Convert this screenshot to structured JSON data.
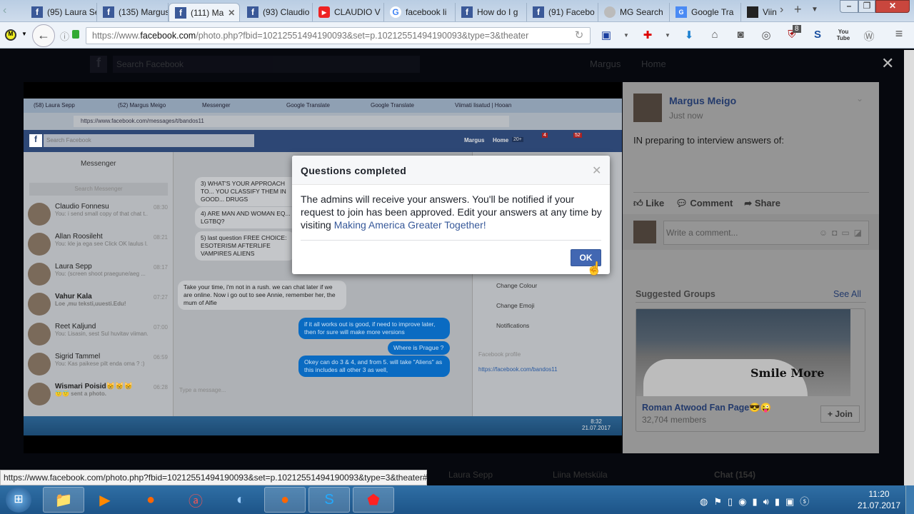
{
  "browser": {
    "tabs": [
      {
        "title": "(95) Laura Sepp",
        "icon": "facebook-icon"
      },
      {
        "title": "(135) Margus",
        "icon": "facebook-icon"
      },
      {
        "title": "(111) Ma",
        "icon": "facebook-icon",
        "active": true
      },
      {
        "title": "(93) Claudio",
        "icon": "facebook-icon"
      },
      {
        "title": "CLAUDIO V",
        "icon": "youtube-icon"
      },
      {
        "title": "facebook li",
        "icon": "google-icon"
      },
      {
        "title": "How do I g",
        "icon": "facebook-icon"
      },
      {
        "title": "(91) Facebo",
        "icon": "facebook-icon"
      },
      {
        "title": "MG Search",
        "icon": "mg-search-icon"
      },
      {
        "title": "Google Tra",
        "icon": "google-translate-icon"
      },
      {
        "title": "Viin",
        "icon": "viin-icon"
      }
    ],
    "url_prefix": "https://www.",
    "url_domain": "facebook.com",
    "url_path": "/photo.php?fbid=10212551494190093&set=p.10212551494190093&type=3&theater",
    "ublock_count": "8",
    "status_url": "https://www.facebook.com/photo.php?fbid=10212551494190093&set=p.10212551494190093&type=3&theater#"
  },
  "fb_header": {
    "search_placeholder": "Search Facebook",
    "user": "Margus",
    "home": "Home"
  },
  "photo": {
    "tabs": [
      "(58) Laura Sepp",
      "(52) Margus Meigo",
      "Messenger",
      "Google Translate",
      "Google Translate",
      "Viimati lisatud | Hooan"
    ],
    "url": "https://www.facebook.com/messages/t/bandos11",
    "search_placeholder": "Search Facebook",
    "user": "Margus",
    "home": "Home",
    "home_badge": "20+",
    "friends_badge": "4",
    "notif_badge": "52",
    "messenger_title": "Messenger",
    "search_messenger": "Search Messenger",
    "conversations": [
      {
        "name": "Claudio Fonnesu",
        "time": "08:30",
        "msg": "You: i send small copy of that chat t..."
      },
      {
        "name": "Allan Roosileht",
        "time": "08:21",
        "msg": "You: kle ja ega see Click OK laulus l..."
      },
      {
        "name": "Laura Sepp",
        "time": "08:17",
        "msg": "You: (screen shoot praegune/aeg ..."
      },
      {
        "name": "Vahur Kala",
        "time": "07:27",
        "msg": "Loe ,mu teksti,uuesti.Edu!"
      },
      {
        "name": "Reet Kaljund",
        "time": "07:00",
        "msg": "You: Lisasin, sest Sul huvitav viiman..."
      },
      {
        "name": "Sigrid Tammel",
        "time": "06:59",
        "msg": "You: Kas paikese pilt enda oma ? :)"
      },
      {
        "name": "Wismari Poisid😸😸😸",
        "time": "06:28",
        "msg": "😇😇 sent a photo."
      }
    ],
    "messages": {
      "q3": "3) WHAT'S YOUR APPROACH TO... YOU CLASSIFY THEM IN GOOD... DRUGS",
      "q4": "4) ARE MAN AND WOMAN EQ... LGTBQ?",
      "q5": "5) last question FREE CHOICE: ESOTERISM AFTERLIFE VAMPIRES ALIENS",
      "reply": "Take your time, i'm not in a rush. we can chat later if we are online. Now i go out to see Annie, remember her, the mum of Alfie",
      "m1": "if it all works out is good, if need to improve later, then for sure will make more versions",
      "m2": "Where is Prague ?",
      "m3": "Okey can do 3 & 4, and from 5. will take \"Aliens\" as this includes all other 3 as well,"
    },
    "type_placeholder": "Type a message...",
    "options": [
      "Change Colour",
      "Change Emoji",
      "Notifications"
    ],
    "profile_label": "Facebook profile",
    "profile_link": "https://facebook.com/bandos11",
    "clock_time": "8:32",
    "clock_date": "21.07.2017"
  },
  "dialog": {
    "title": "Questions completed",
    "body": "The admins will receive your answers. You'll be notified if your request to join has been approved. Edit your answers at any time by visiting ",
    "link": "Making America Greater Together!",
    "ok": "OK"
  },
  "post": {
    "author": "Margus Meigo",
    "time": "Just now",
    "text": "IN preparing to interview answers of:",
    "actions": [
      "Like",
      "Comment",
      "Share"
    ],
    "comment_placeholder": "Write a comment..."
  },
  "suggested": {
    "title": "Suggested Groups",
    "see_all": "See All",
    "group_name": "Roman Atwood Fan Page😎😜",
    "members": "32,704 members",
    "join": "+ Join",
    "image_text": "Smile More"
  },
  "bg_chat": {
    "names": [
      "Laura Sepp",
      "Liina Metsküla"
    ],
    "chat": "Chat (154)"
  },
  "taskbar": {
    "time": "11:20",
    "date": "21.07.2017"
  }
}
